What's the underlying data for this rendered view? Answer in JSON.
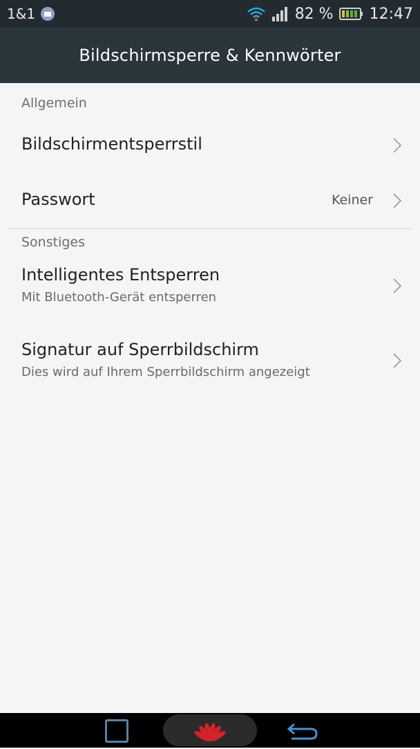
{
  "status": {
    "carrier": "1&1",
    "battery_pct": "82 %",
    "time": "12:47"
  },
  "title": "Bildschirmsperre & Kennwörter",
  "sections": [
    {
      "header": "Allgemein",
      "items": [
        {
          "title": "Bildschirmentsperrstil",
          "subtitle": "",
          "value": ""
        },
        {
          "title": "Passwort",
          "subtitle": "",
          "value": "Keiner"
        }
      ]
    },
    {
      "header": "Sonstiges",
      "items": [
        {
          "title": "Intelligentes Entsperren",
          "subtitle": "Mit Bluetooth-Gerät entsperren",
          "value": ""
        },
        {
          "title": "Signatur auf Sperrbildschirm",
          "subtitle": "Dies wird auf Ihrem Sperrbildschirm angezeigt",
          "value": ""
        }
      ]
    }
  ],
  "icons": {
    "mail": "mail-notification-icon",
    "wifi": "wifi-icon",
    "signal": "signal-icon",
    "battery": "battery-icon",
    "chevron": "chevron-right-icon",
    "recent": "recent-apps-icon",
    "home": "huawei-logo-home-icon",
    "back": "back-icon"
  },
  "colors": {
    "statusbar": "#232a30",
    "titlebar": "#2b353c",
    "background": "#f5f5f5",
    "wifi": "#2aa7e0"
  }
}
